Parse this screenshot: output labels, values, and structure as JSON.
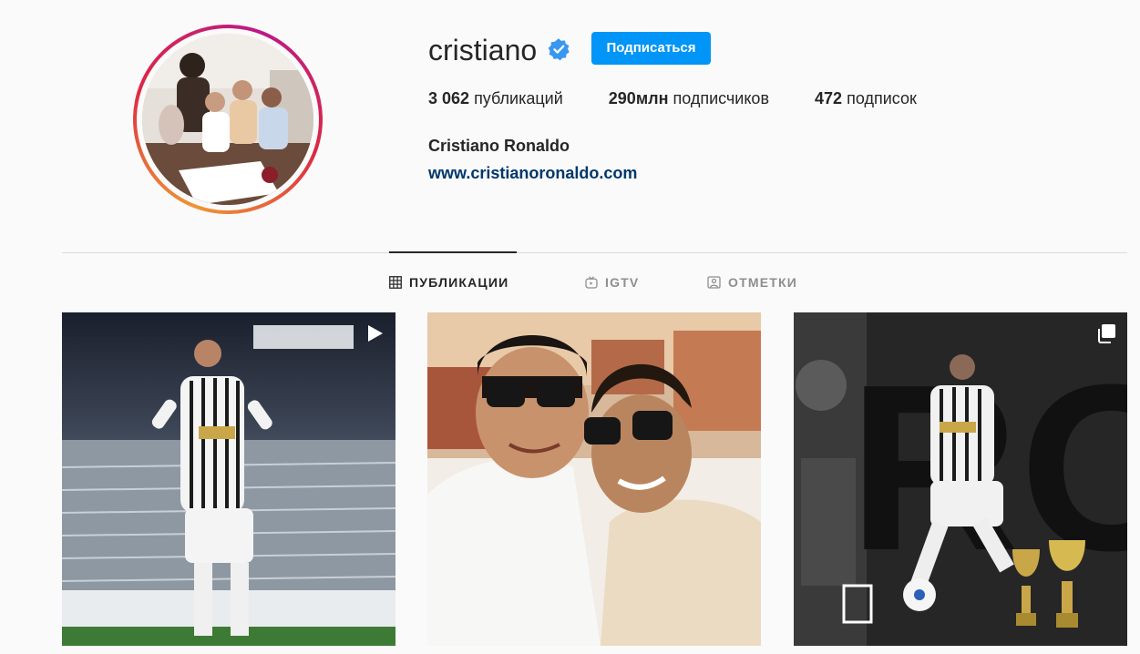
{
  "profile": {
    "username": "cristiano",
    "follow_label": "Подписаться",
    "stats": {
      "posts_value": "3 062",
      "posts_label": "публикаций",
      "followers_value": "290млн",
      "followers_label": "подписчиков",
      "following_value": "472",
      "following_label": "подписок"
    },
    "full_name": "Cristiano Ronaldo",
    "website": "www.cristianoronaldo.com"
  },
  "tabs": [
    {
      "label": "ПУБЛИКАЦИИ",
      "icon": "grid-icon",
      "active": true
    },
    {
      "label": "IGTV",
      "icon": "igtv-icon",
      "active": false
    },
    {
      "label": "ОТМЕТКИ",
      "icon": "tagged-icon",
      "active": false
    }
  ],
  "posts": [
    {
      "type": "video",
      "badge_icon": "play-icon"
    },
    {
      "type": "image",
      "badge_icon": ""
    },
    {
      "type": "carousel",
      "badge_icon": "carousel-icon"
    }
  ],
  "colors": {
    "accent": "#0095f6",
    "link": "#00376b",
    "verified": "#3897f0"
  }
}
